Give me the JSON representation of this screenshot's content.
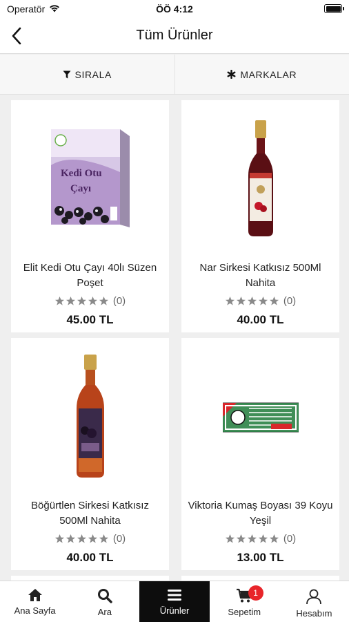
{
  "status_bar": {
    "carrier": "Operatör",
    "time": "ÖÖ 4:12"
  },
  "header": {
    "title": "Tüm Ürünler"
  },
  "filters": {
    "sort_label": "SIRALA",
    "brands_label": "MARKALAR"
  },
  "products": [
    {
      "name": "Elit Kedi Otu Çayı 40lı Süzen Poşet",
      "reviews": "(0)",
      "price": "45.00 TL",
      "rating": 0
    },
    {
      "name": "Nar Sirkesi Katkısız 500Ml Nahita",
      "reviews": "(0)",
      "price": "40.00 TL",
      "rating": 0
    },
    {
      "name": "Böğürtlen Sirkesi Katkısız 500Ml Nahita",
      "reviews": "(0)",
      "price": "40.00 TL",
      "rating": 0
    },
    {
      "name": "Viktoria Kumaş Boyası 39 Koyu Yeşil",
      "reviews": "(0)",
      "price": "13.00 TL",
      "rating": 0
    }
  ],
  "tab_bar": {
    "home": "Ana Sayfa",
    "search": "Ara",
    "products": "Ürünler",
    "cart": "Sepetim",
    "cart_badge": "1",
    "account": "Hesabım"
  },
  "colors": {
    "active_tab": "#0d0d0d",
    "badge": "#e8252a",
    "star": "#8a8a8a"
  }
}
